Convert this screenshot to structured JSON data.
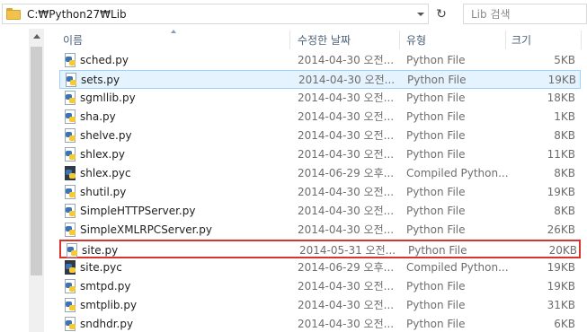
{
  "address": {
    "path": "C:₩Python27₩Lib"
  },
  "search": {
    "placeholder": "Lib 검색"
  },
  "columns": {
    "name": "이름",
    "date": "수정한 날짜",
    "type": "유형",
    "size": "크기"
  },
  "files": [
    {
      "name": "sched.py",
      "date": "2014-04-30 오전...",
      "type": "Python File",
      "size": "5KB",
      "icon": "python-file-icon"
    },
    {
      "name": "sets.py",
      "date": "2014-04-30 오전...",
      "type": "Python File",
      "size": "19KB",
      "icon": "python-file-icon",
      "state": "selected"
    },
    {
      "name": "sgmllib.py",
      "date": "2014-04-30 오전...",
      "type": "Python File",
      "size": "18KB",
      "icon": "python-file-icon"
    },
    {
      "name": "sha.py",
      "date": "2014-04-30 오전...",
      "type": "Python File",
      "size": "1KB",
      "icon": "python-file-icon"
    },
    {
      "name": "shelve.py",
      "date": "2014-04-30 오전...",
      "type": "Python File",
      "size": "8KB",
      "icon": "python-file-icon"
    },
    {
      "name": "shlex.py",
      "date": "2014-04-30 오전...",
      "type": "Python File",
      "size": "11KB",
      "icon": "python-file-icon"
    },
    {
      "name": "shlex.pyc",
      "date": "2014-06-29 오후...",
      "type": "Compiled Python...",
      "size": "8KB",
      "icon": "compiled-python-icon"
    },
    {
      "name": "shutil.py",
      "date": "2014-04-30 오전...",
      "type": "Python File",
      "size": "19KB",
      "icon": "python-file-icon"
    },
    {
      "name": "SimpleHTTPServer.py",
      "date": "2014-04-30 오전...",
      "type": "Python File",
      "size": "8KB",
      "icon": "python-file-icon"
    },
    {
      "name": "SimpleXMLRPCServer.py",
      "date": "2014-04-30 오전...",
      "type": "Python File",
      "size": "26KB",
      "icon": "python-file-icon"
    },
    {
      "name": "site.py",
      "date": "2014-05-31 오전...",
      "type": "Python File",
      "size": "20KB",
      "icon": "python-file-icon",
      "state": "highlighted"
    },
    {
      "name": "site.pyc",
      "date": "2014-06-29 오후...",
      "type": "Compiled Python...",
      "size": "19KB",
      "icon": "compiled-python-icon"
    },
    {
      "name": "smtpd.py",
      "date": "2014-04-30 오전...",
      "type": "Python File",
      "size": "19KB",
      "icon": "python-file-icon"
    },
    {
      "name": "smtplib.py",
      "date": "2014-04-30 오전...",
      "type": "Python File",
      "size": "31KB",
      "icon": "python-file-icon"
    },
    {
      "name": "sndhdr.py",
      "date": "2014-04-30 오전...",
      "type": "Python File",
      "size": "6KB",
      "icon": "python-file-icon"
    }
  ],
  "colors": {
    "selected_bg": "#e5f3ff",
    "selected_border": "#99d1ff",
    "highlight_border": "#d9342b",
    "header_text": "#4c607a"
  }
}
